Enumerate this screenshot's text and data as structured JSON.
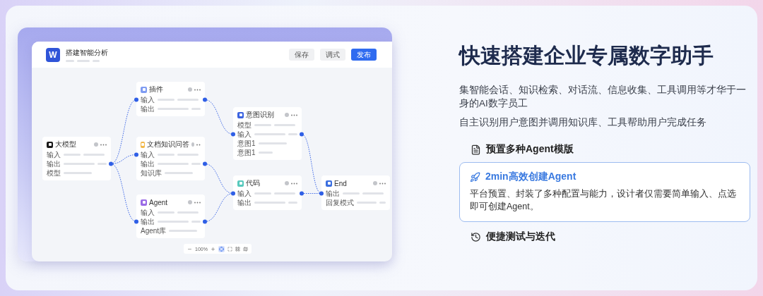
{
  "app": {
    "logo": "W",
    "title": "搭建智能分析",
    "buttons": [
      {
        "label": "保存",
        "kind": "secondary"
      },
      {
        "label": "调式",
        "kind": "secondary"
      },
      {
        "label": "发布",
        "kind": "primary"
      }
    ]
  },
  "nodes": [
    {
      "title": "插件",
      "kind": "plugin",
      "rows": [
        "输入",
        "输出"
      ]
    },
    {
      "title": "意图识别",
      "kind": "intent",
      "rows": [
        "模型",
        "输入",
        "意图1",
        "意图1"
      ]
    },
    {
      "title": "大模型",
      "kind": "llm",
      "rows": [
        "输入",
        "输出",
        "模型"
      ]
    },
    {
      "title": "文档知识问答",
      "kind": "doc",
      "rows": [
        "输入",
        "输出",
        "知识库"
      ]
    },
    {
      "title": "代码",
      "kind": "code",
      "rows": [
        "输入",
        "输出"
      ]
    },
    {
      "title": "End",
      "kind": "end",
      "rows": [
        "输出",
        "回复模式"
      ]
    },
    {
      "title": "Agent",
      "kind": "agent",
      "rows": [
        "输入",
        "输出",
        "Agent库"
      ]
    }
  ],
  "zoom_bar": {
    "zoom": "100%"
  },
  "heading": "快速搭建企业专属数字助手",
  "paragraphs": [
    "集智能会话、知识检索、对话流、信息收集、工具调用等才华于一身的AI数字员工",
    "自主识别用户意图并调用知识库、工具帮助用户完成任务"
  ],
  "features": [
    {
      "title": "预置多种Agent模版",
      "selected": false
    },
    {
      "title": "2min高效创建Agent",
      "selected": true,
      "description": "平台预置、封装了多种配置与能力，设计者仅需要简单输入、点选即可创建Agent。"
    },
    {
      "title": "便捷测试与迭代",
      "selected": false
    }
  ]
}
